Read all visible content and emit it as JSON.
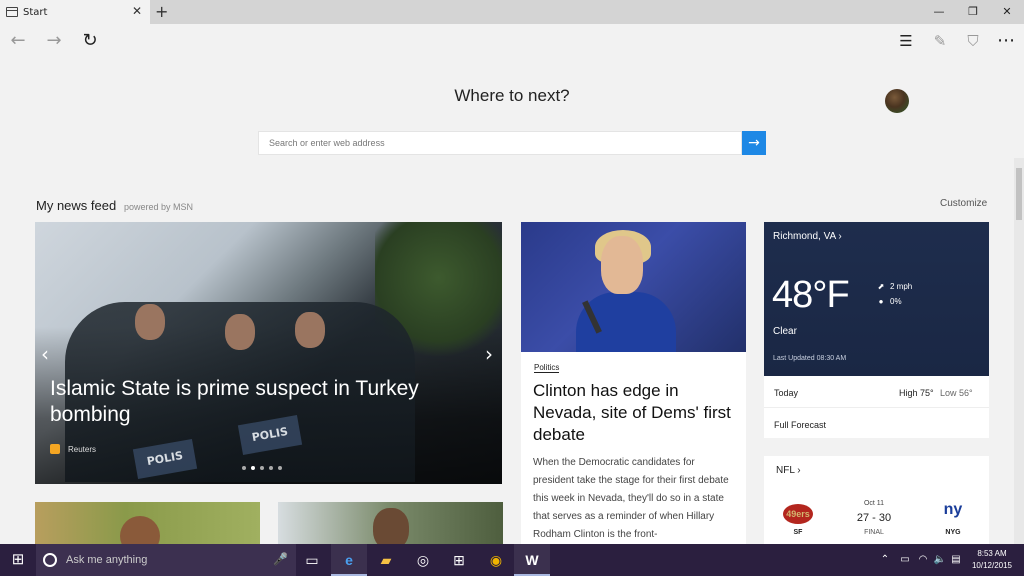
{
  "browser": {
    "tab_title": "Start",
    "tab_close": "✕",
    "new_tab": "+",
    "win_minimize": "—",
    "win_restore": "❐",
    "win_close": "✕",
    "nav": {
      "back": "←",
      "forward": "→",
      "refresh": "↻",
      "hub": "☰",
      "note": "✎",
      "share": "⛉",
      "more": "⋯"
    }
  },
  "start_page": {
    "heading": "Where to next?",
    "search_placeholder": "Search or enter web address",
    "search_go": "→"
  },
  "feed": {
    "title": "My news feed",
    "powered_by": "powered by MSN",
    "customize": "Customize",
    "hero": {
      "title": "Islamic State is prime suspect in Turkey bombing",
      "source": "Reuters",
      "shield_text": "POLIS",
      "prev": "‹",
      "next": "›",
      "carousel_count": 5,
      "carousel_active": 1
    },
    "article": {
      "category": "Politics",
      "title": "Clinton has edge in Nevada, site of Dems' first debate",
      "body": "When the Democratic candidates for president take the stage for their first debate this week in Nevada, they'll do so in a state that serves as a reminder of when Hillary Rodham Clinton is the front-"
    }
  },
  "weather": {
    "city": "Richmond, VA ›",
    "temp": "48°F",
    "condition": "Clear",
    "updated": "Last Updated 08:30 AM",
    "wind": "2 mph",
    "precip": "0%",
    "wind_icon": "⬈",
    "precip_icon": "●",
    "today": "Today",
    "high": "High 75°",
    "low": "Low 56°",
    "full_forecast": "Full Forecast"
  },
  "nfl": {
    "title": "NFL ›",
    "date": "Oct 11",
    "score": "27 - 30",
    "status": "FINAL",
    "home_abbr": "SF",
    "away_abbr": "NYG",
    "home_logo": "49ers",
    "away_logo": "ny",
    "colors": {
      "sf_red": "#b3261e",
      "nyg_blue": "#1a3d9a"
    }
  },
  "taskbar": {
    "start": "⊞",
    "cortana_placeholder": "Ask me anything",
    "mic": "🎤",
    "apps": [
      {
        "name": "task-view",
        "glyph": "▭"
      },
      {
        "name": "edge",
        "glyph": "e"
      },
      {
        "name": "file-explorer",
        "glyph": "▰"
      },
      {
        "name": "groove",
        "glyph": "◎"
      },
      {
        "name": "store",
        "glyph": "⊞"
      },
      {
        "name": "chrome",
        "glyph": "◉"
      },
      {
        "name": "word",
        "glyph": "W"
      }
    ],
    "tray": {
      "chevron": "⌃",
      "battery": "▭",
      "wifi": "◠",
      "volume": "🔈",
      "notify": "▤"
    },
    "time": "8:53 AM",
    "date": "10/12/2015"
  },
  "colors": {
    "accent": "#1e88e5",
    "taskbar": "#2b1f3f",
    "weather_bg": "#1e2d4d"
  }
}
